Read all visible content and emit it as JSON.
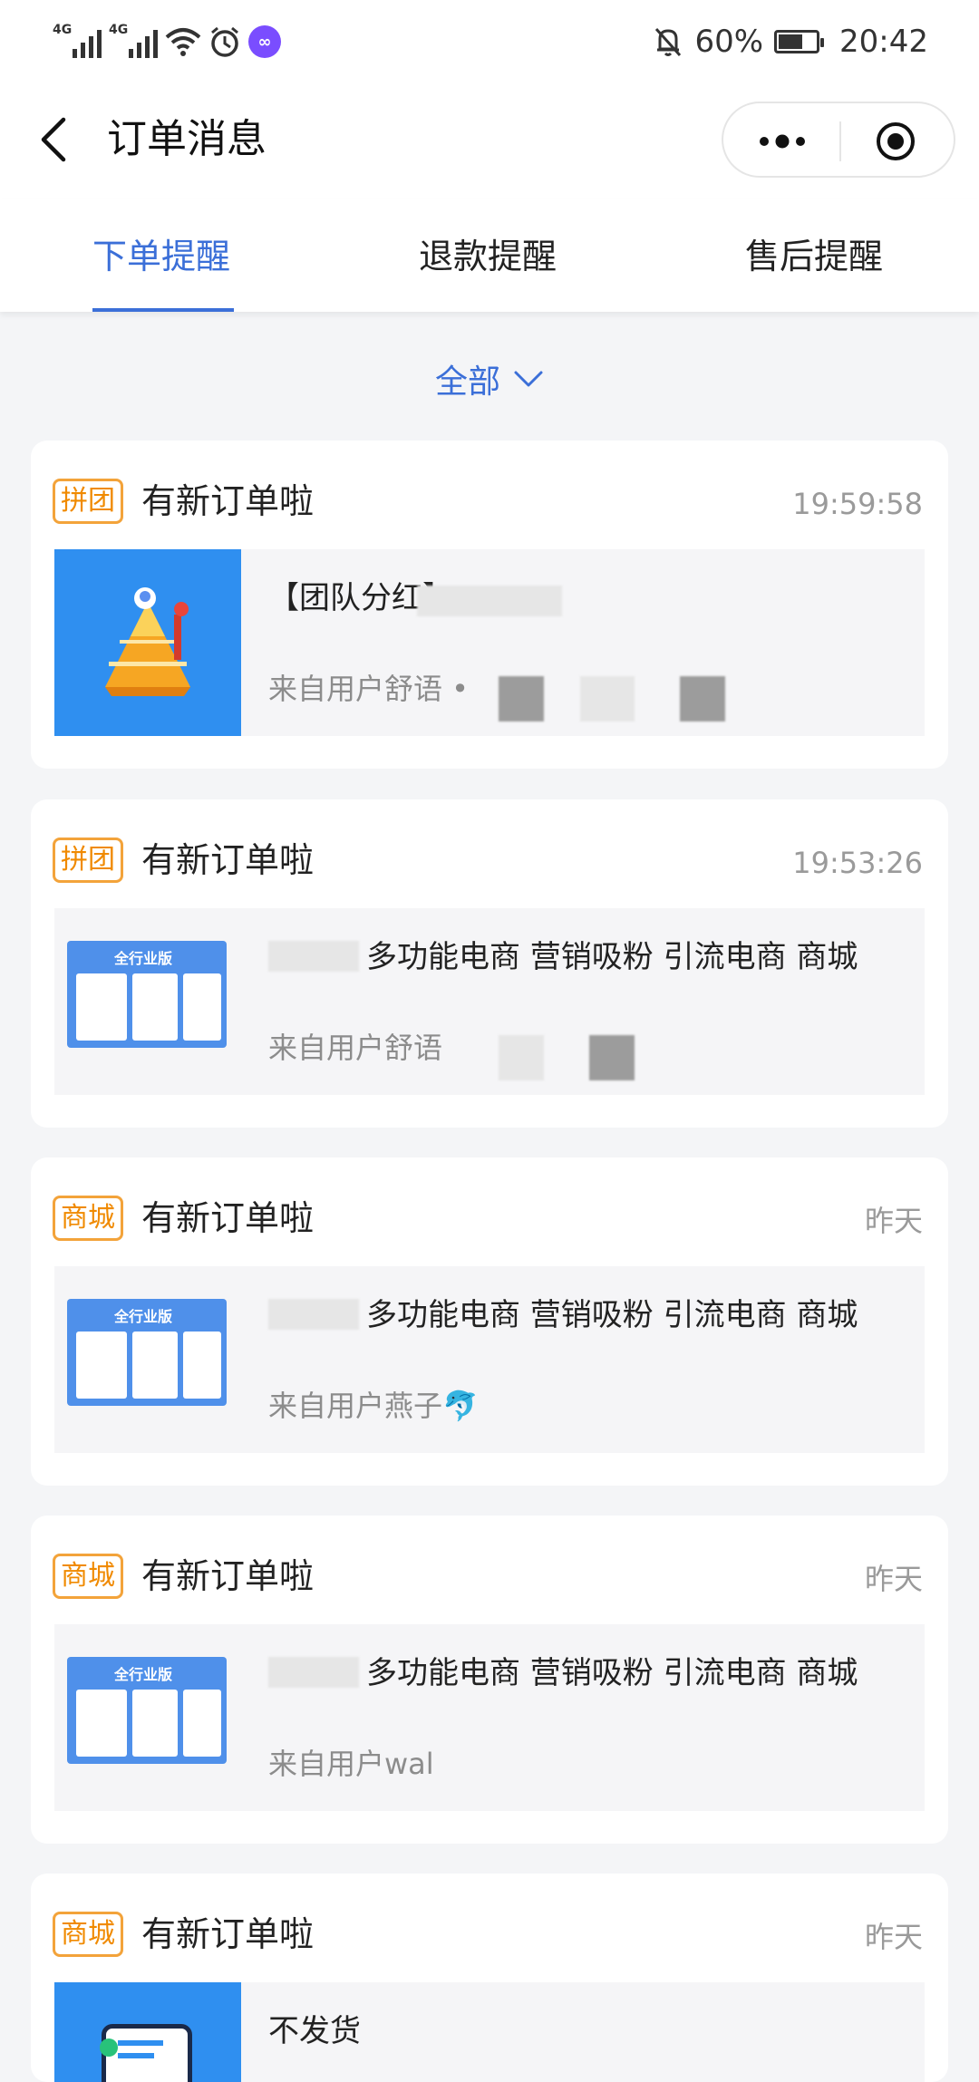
{
  "status_bar": {
    "net1": "4G",
    "net2": "4G",
    "battery_pct": "60%",
    "time": "20:42"
  },
  "nav": {
    "title": "订单消息"
  },
  "tabs": [
    {
      "label": "下单提醒",
      "active": true
    },
    {
      "label": "退款提醒",
      "active": false
    },
    {
      "label": "售后提醒",
      "active": false
    }
  ],
  "filter": {
    "label": "全部"
  },
  "orders": [
    {
      "badge": "拼团",
      "title": "有新订单啦",
      "time": "19:59:58",
      "product": "【团队分红】",
      "from": "来自用户舒语 •"
    },
    {
      "badge": "拼团",
      "title": "有新订单啦",
      "time": "19:53:26",
      "product": "多功能电商 营销吸粉 引流电商 商城",
      "from": "来自用户舒语"
    },
    {
      "badge": "商城",
      "title": "有新订单啦",
      "time": "昨天",
      "product": "多功能电商 营销吸粉 引流电商 商城",
      "from": "来自用户燕子🐬"
    },
    {
      "badge": "商城",
      "title": "有新订单啦",
      "time": "昨天",
      "product": "多功能电商 营销吸粉 引流电商 商城",
      "from": "来自用户wal"
    },
    {
      "badge": "商城",
      "title": "有新订单啦",
      "time": "昨天",
      "product": "不发货",
      "from": ""
    }
  ],
  "thumb_text": {
    "banner": "全行业版"
  },
  "colors": {
    "accent": "#3b6fd8",
    "badge_orange": "#f08a00",
    "thumb_blue": "#2f8ff0"
  }
}
